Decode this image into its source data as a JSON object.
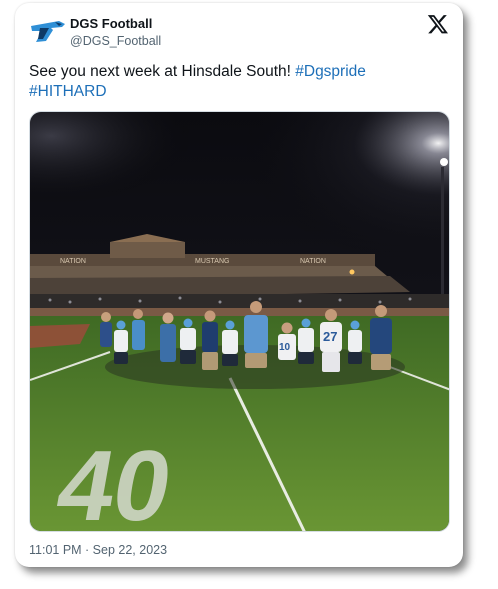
{
  "author": {
    "display_name": "DGS Football",
    "handle": "@DGS_Football",
    "avatar_icon": "mustang-logo-icon"
  },
  "platform_icon": "x-logo-icon",
  "tweet": {
    "text": "See you next week at Hinsdale South! ",
    "hashtags": [
      "#Dgspride",
      "#HITHARD"
    ]
  },
  "media": {
    "stadium_banners": [
      "NATION",
      "MUSTANG",
      "NATION"
    ],
    "yard_number": "40",
    "jersey_numbers": [
      "27",
      "10"
    ]
  },
  "timestamp": "11:01 PM · Sep 22, 2023",
  "colors": {
    "hashtag": "#1d6fb8",
    "brand_blue": "#2f8fd6",
    "turf": "#5f8a2e"
  }
}
